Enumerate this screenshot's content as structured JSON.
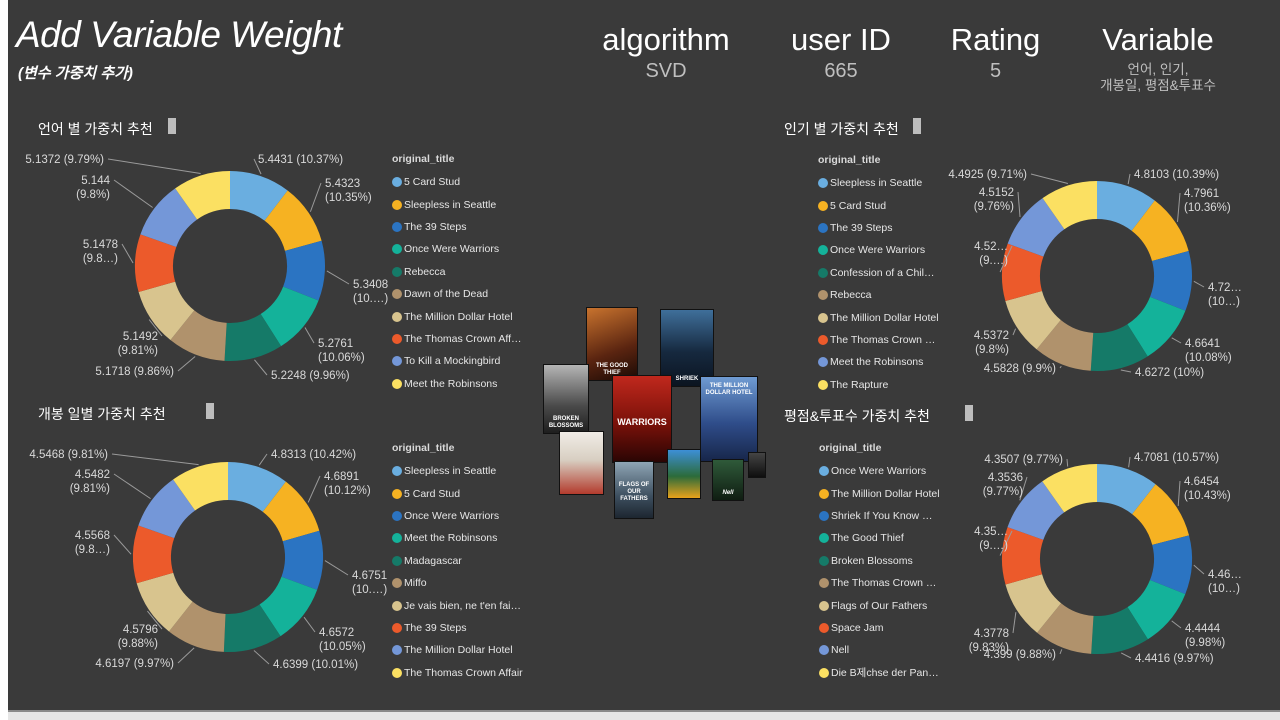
{
  "page": {
    "title": "Add Variable Weight",
    "subtitle": "(변수 가중치 추가)"
  },
  "header": {
    "algorithm": {
      "label": "algorithm",
      "value": "SVD"
    },
    "user_id": {
      "label": "user ID",
      "value": "665"
    },
    "rating": {
      "label": "Rating",
      "value": "5"
    },
    "variable": {
      "label": "Variable",
      "value_line1": "언어, 인기,",
      "value_line2": "개봉일, 평점&투표수"
    }
  },
  "colors": [
    "#6aaee0",
    "#f6b222",
    "#2b74c2",
    "#14b29a",
    "#157a68",
    "#b0926c",
    "#d8c48e",
    "#ec5a2b",
    "#7497d8",
    "#fbe062"
  ],
  "sections": [
    {
      "key": "language",
      "title": "언어 별 가중치 추천",
      "legend_title": "original_title",
      "legend": [
        "5 Card Stud",
        "Sleepless in Seattle",
        "The 39 Steps",
        "Once Were Warriors",
        "Rebecca",
        "Dawn of the Dead",
        "The Million Dollar Hotel",
        "The Thomas Crown Aff…",
        "To Kill a Mockingbird",
        "Meet the Robinsons"
      ],
      "values": [
        5.4431,
        5.4323,
        5.3408,
        5.2761,
        5.2248,
        5.1718,
        5.1492,
        5.1478,
        5.144,
        5.1372
      ],
      "labels": [
        [
          "5.4431 (10.37%)"
        ],
        [
          "5.4323",
          "(10.35%)"
        ],
        [
          "5.3408",
          "(10.…)"
        ],
        [
          "5.2761",
          "(10.06%)"
        ],
        [
          "5.2248 (9.96%)"
        ],
        [
          "5.1718 (9.86%)"
        ],
        [
          "5.1492",
          "(9.81%)"
        ],
        [
          "5.1478",
          "(9.8…)"
        ],
        [
          "5.144",
          "(9.8%)"
        ],
        [
          "5.1372 (9.79%)"
        ]
      ]
    },
    {
      "key": "popularity",
      "title": "인기 별 가중치 추천",
      "legend_title": "original_title",
      "legend": [
        "Sleepless in Seattle",
        "5 Card Stud",
        "The 39 Steps",
        "Once Were Warriors",
        "Confession of a Chil…",
        "Rebecca",
        "The Million Dollar Hotel",
        "The Thomas Crown …",
        "Meet the Robinsons",
        "The Rapture"
      ],
      "values": [
        4.8103,
        4.7961,
        4.72,
        4.6641,
        4.6272,
        4.5828,
        4.5372,
        4.52,
        4.5152,
        4.4925
      ],
      "labels": [
        [
          "4.8103 (10.39%)"
        ],
        [
          "4.7961",
          "(10.36%)"
        ],
        [
          "4.72…",
          "(10…)"
        ],
        [
          "4.6641",
          "(10.08%)"
        ],
        [
          "4.6272 (10%)"
        ],
        [
          "4.5828 (9.9%)"
        ],
        [
          "4.5372",
          "(9.8%)"
        ],
        [
          "4.52…",
          "(9.…)"
        ],
        [
          "4.5152",
          "(9.76%)"
        ],
        [
          "4.4925 (9.71%)"
        ]
      ]
    },
    {
      "key": "release",
      "title": "개봉 일별 가중치 추천",
      "legend_title": "original_title",
      "legend": [
        "Sleepless in Seattle",
        "5 Card Stud",
        "Once Were Warriors",
        "Meet the Robinsons",
        "Madagascar",
        "Miffo",
        "Je vais bien, ne t'en fai…",
        "The 39 Steps",
        "The Million Dollar Hotel",
        "The Thomas Crown Affair"
      ],
      "values": [
        4.8313,
        4.6891,
        4.6751,
        4.6572,
        4.6399,
        4.6197,
        4.5796,
        4.5568,
        4.5482,
        4.5468
      ],
      "labels": [
        [
          "4.8313 (10.42%)"
        ],
        [
          "4.6891",
          "(10.12%)"
        ],
        [
          "4.6751",
          "(10.…)"
        ],
        [
          "4.6572",
          "(10.05%)"
        ],
        [
          "4.6399 (10.01%)"
        ],
        [
          "4.6197 (9.97%)"
        ],
        [
          "4.5796",
          "(9.88%)"
        ],
        [
          "4.5568",
          "(9.8…)"
        ],
        [
          "4.5482",
          "(9.81%)"
        ],
        [
          "4.5468 (9.81%)"
        ]
      ]
    },
    {
      "key": "rating_votes",
      "title": "평점&투표수 가중치 추천",
      "legend_title": "original_title",
      "legend": [
        "Once Were Warriors",
        "The Million Dollar Hotel",
        "Shriek If You Know …",
        "The Good Thief",
        "Broken Blossoms",
        "The Thomas Crown …",
        "Flags of Our Fathers",
        "Space Jam",
        "Nell",
        "Die B제chse der Pan…"
      ],
      "values": [
        4.7081,
        4.6454,
        4.46,
        4.4444,
        4.4416,
        4.399,
        4.3778,
        4.35,
        4.3536,
        4.3507
      ],
      "labels": [
        [
          "4.7081 (10.57%)"
        ],
        [
          "4.6454",
          "(10.43%)"
        ],
        [
          "4.46…",
          "(10…)"
        ],
        [
          "4.4444",
          "(9.98%)"
        ],
        [
          "4.4416 (9.97%)"
        ],
        [
          "4.399 (9.88%)"
        ],
        [
          "4.3778",
          "(9.83%)"
        ],
        [
          "4.35…",
          "(9.…)"
        ],
        [
          "4.3536",
          "(9.77%)"
        ],
        [
          "4.3507 (9.77%)"
        ]
      ]
    }
  ],
  "posters": [
    {
      "name": "poster-the-good-thief",
      "text": "THE GOOD THIEF"
    },
    {
      "name": "poster-shriek",
      "text": "SHRIEK"
    },
    {
      "name": "poster-broken-blossoms",
      "text": "BROKEN BLOSSOMS"
    },
    {
      "name": "poster-once-were-warriors",
      "text": "WARRIORS"
    },
    {
      "name": "poster-million-dollar-hotel",
      "text": "THE MILLION DOLLAR HOTEL"
    },
    {
      "name": "poster-sleepless-in-seattle",
      "text": ""
    },
    {
      "name": "poster-flags-of-our-fathers",
      "text": "FLAGS OF OUR FATHERS"
    },
    {
      "name": "poster-space-jam",
      "text": ""
    },
    {
      "name": "poster-nell",
      "text": "Nell"
    },
    {
      "name": "poster-small",
      "text": ""
    }
  ]
}
